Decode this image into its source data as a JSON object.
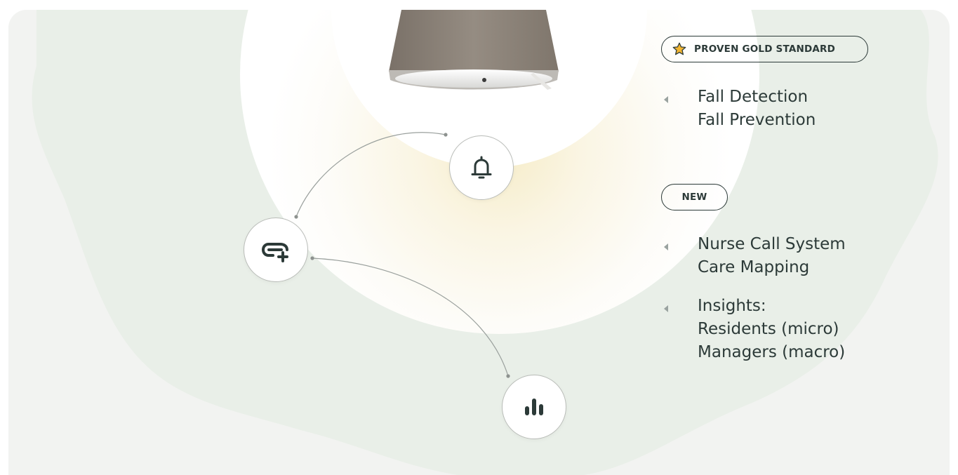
{
  "colors": {
    "background_outer": "#f2f3f1",
    "blob": "#e9efe8",
    "glow_center": "#f6ecc8",
    "text_dark": "#2c3a38",
    "star_fill": "#f2b531",
    "lamp_shade": "#8a8177"
  },
  "badges": {
    "gold_standard": {
      "label": "PROVEN GOLD STANDARD",
      "icon": "star-icon"
    },
    "new": {
      "label": "NEW"
    }
  },
  "features": [
    {
      "lines": [
        "Fall Detection",
        "Fall Prevention"
      ]
    },
    {
      "lines": [
        "Nurse Call System",
        "Care Mapping"
      ]
    },
    {
      "lines": [
        "Insights:",
        "Residents (micro)",
        "Managers (macro)"
      ]
    }
  ],
  "nodes": [
    {
      "name": "bell-node",
      "icon": "bell-icon"
    },
    {
      "name": "care-node",
      "icon": "link-plus-icon"
    },
    {
      "name": "insights-node",
      "icon": "bar-chart-icon"
    }
  ]
}
